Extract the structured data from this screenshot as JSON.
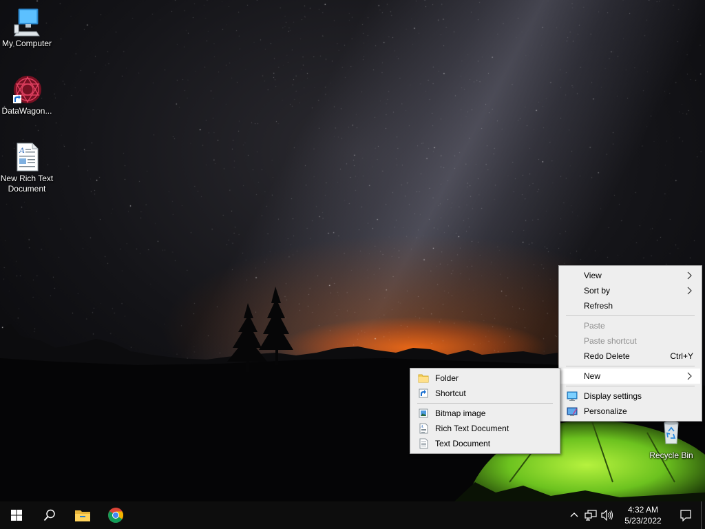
{
  "desktop_icons": [
    {
      "label": "My Computer",
      "icon": "computer-icon"
    },
    {
      "label": "DataWagon...",
      "icon": "datawagon-shortcut-icon"
    },
    {
      "label": "New Rich Text Document",
      "icon": "rich-text-document-icon"
    },
    {
      "label": "Recycle Bin",
      "icon": "recycle-bin-icon"
    }
  ],
  "context_menu": {
    "items": [
      {
        "label": "View",
        "submenu": true
      },
      {
        "label": "Sort by",
        "submenu": true
      },
      {
        "label": "Refresh"
      },
      {
        "label": "Paste",
        "disabled": true
      },
      {
        "label": "Paste shortcut",
        "disabled": true
      },
      {
        "label": "Redo Delete",
        "shortcut": "Ctrl+Y"
      },
      {
        "label": "New",
        "submenu": true,
        "highlighted": true
      },
      {
        "label": "Display settings",
        "icon": "display-settings-icon"
      },
      {
        "label": "Personalize",
        "icon": "personalize-icon"
      }
    ]
  },
  "new_submenu": {
    "items": [
      {
        "label": "Folder",
        "icon": "folder-icon"
      },
      {
        "label": "Shortcut",
        "icon": "shortcut-icon"
      },
      {
        "label": "Bitmap image",
        "icon": "bitmap-image-icon"
      },
      {
        "label": "Rich Text Document",
        "icon": "rich-text-icon"
      },
      {
        "label": "Text Document",
        "icon": "text-document-icon"
      }
    ]
  },
  "taskbar": {
    "buttons": [
      {
        "icon": "windows-start-icon"
      },
      {
        "icon": "search-icon"
      },
      {
        "icon": "file-explorer-icon"
      },
      {
        "icon": "chrome-icon"
      }
    ],
    "tray": {
      "icons": [
        "chevron-up-icon",
        "network-icon",
        "volume-icon"
      ],
      "time": "4:32 AM",
      "date": "5/23/2022",
      "notification_icon": "notification-icon"
    }
  },
  "colors": {
    "menu_bg": "#eeeeee",
    "menu_highlight": "#ffffff",
    "disabled_text": "#8d8d8d",
    "taskbar_bg": "#0d0d0d",
    "tent_green": "#7cd62a"
  }
}
